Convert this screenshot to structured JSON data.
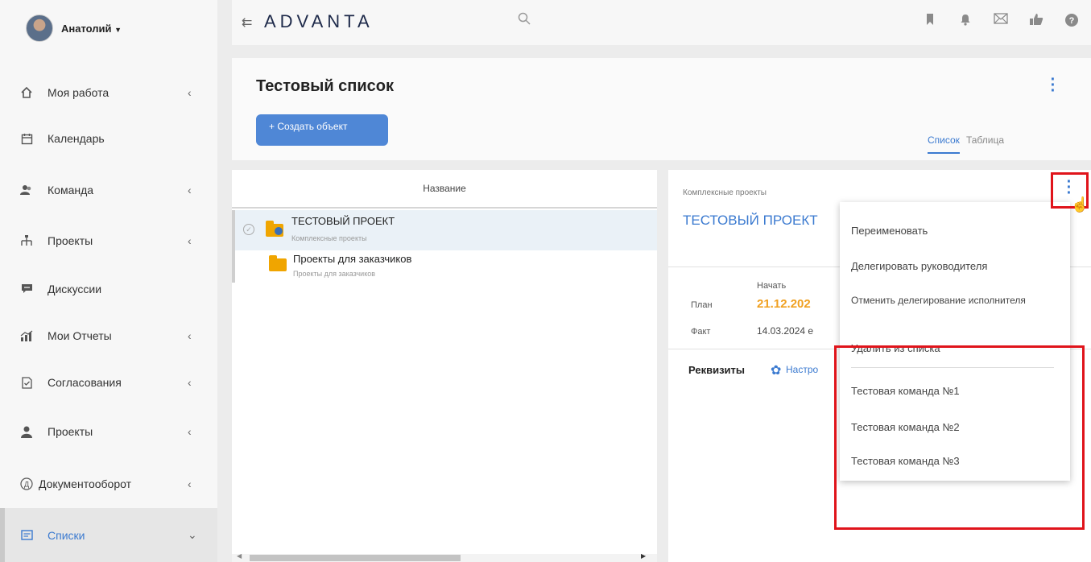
{
  "user": {
    "name": "Анатолий"
  },
  "sidebar": {
    "items": [
      {
        "label": "Моя работа",
        "icon": "home-icon",
        "arrow": "‹"
      },
      {
        "label": "Календарь",
        "icon": "calendar-icon",
        "arrow": ""
      },
      {
        "label": "Команда",
        "icon": "team-icon",
        "arrow": "‹"
      },
      {
        "label": "Проекты",
        "icon": "hierarchy-icon",
        "arrow": "‹"
      },
      {
        "label": "Дискуссии",
        "icon": "chat-icon",
        "arrow": ""
      },
      {
        "label": "Мои Отчеты",
        "icon": "report-icon",
        "arrow": "‹"
      },
      {
        "label": "Согласования",
        "icon": "approval-icon",
        "arrow": "‹"
      },
      {
        "label": "Проекты",
        "icon": "person-icon",
        "arrow": "‹"
      },
      {
        "label": "Документооборот",
        "icon": "document-flow-icon",
        "arrow": "‹"
      },
      {
        "label": "Списки",
        "icon": "list-icon",
        "arrow": "⌄"
      }
    ]
  },
  "topbar": {
    "logo": "ADVANTA",
    "icons": [
      "bookmark-icon",
      "bell-icon",
      "mail-icon",
      "thumbs-up-icon",
      "help-icon"
    ]
  },
  "header": {
    "title": "Тестовый список",
    "create_button": "+ Создать объект",
    "tabs": [
      {
        "label": "Список",
        "active": true
      },
      {
        "label": "Таблица",
        "active": false
      }
    ]
  },
  "list": {
    "column_header": "Название",
    "rows": [
      {
        "title": "ТЕСТОВЫЙ ПРОЕКТ",
        "subtitle": "Комплексные проекты"
      },
      {
        "title": "Проекты для заказчиков",
        "subtitle": "Проекты для заказчиков"
      }
    ]
  },
  "detail": {
    "category": "Комплексные проекты",
    "title": "ТЕСТОВЫЙ ПРОЕКТ",
    "start_label": "Начать",
    "plan_label": "План",
    "plan_value": "21.12.202",
    "fact_label": "Факт",
    "fact_value": "14.03.2024 e",
    "rekv_label": "Реквизиты",
    "setup_link": "Настро"
  },
  "context_menu": {
    "items": [
      "Переименовать",
      "Делегировать руководителя",
      "Отменить делегирование исполнителя",
      "Удалить из списка",
      "Тестовая команда №1",
      "Тестовая команда №2",
      "Тестовая команда №3"
    ]
  },
  "colors": {
    "accent": "#3b7ad0",
    "button": "#4f87d6",
    "plan_date": "#f0a020",
    "highlight": "#e0141b"
  }
}
